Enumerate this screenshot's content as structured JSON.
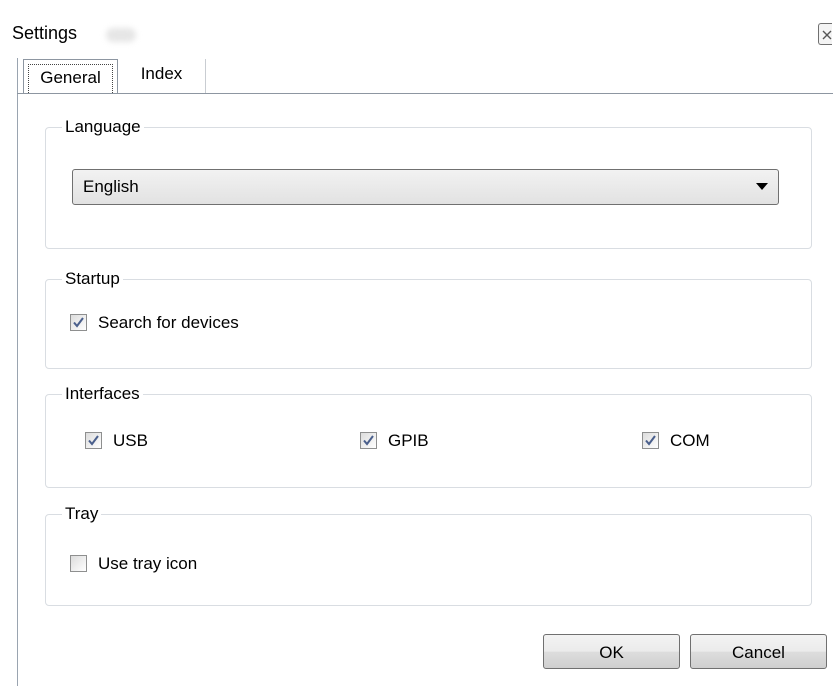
{
  "window": {
    "title": "Settings"
  },
  "tabs": [
    {
      "label": "General",
      "selected": true
    },
    {
      "label": "Index",
      "selected": false
    }
  ],
  "language": {
    "group_label": "Language",
    "selected": "English"
  },
  "startup": {
    "group_label": "Startup",
    "search_for_devices": {
      "label": "Search for devices",
      "checked": true
    }
  },
  "interfaces": {
    "group_label": "Interfaces",
    "items": [
      {
        "label": "USB",
        "checked": true
      },
      {
        "label": "GPIB",
        "checked": true
      },
      {
        "label": "COM",
        "checked": true
      }
    ]
  },
  "tray": {
    "group_label": "Tray",
    "use_tray_icon": {
      "label": "Use tray icon",
      "checked": false
    }
  },
  "buttons": {
    "ok_label": "OK",
    "cancel_label": "Cancel"
  },
  "icons": {
    "close": "close-icon",
    "dropdown": "chevron-down-icon",
    "check": "checkmark-icon"
  },
  "colors": {
    "border": "#8d96a1",
    "group_border": "#d9dde2",
    "check_mark": "#4a5f8c"
  }
}
